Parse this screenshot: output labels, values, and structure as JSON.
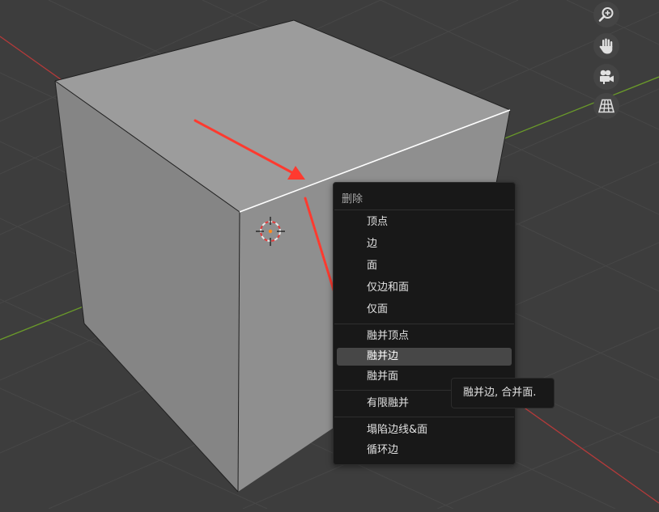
{
  "viewport": {
    "nav_icons": [
      "zoom-icon",
      "hand-pan-icon",
      "camera-icon",
      "grid-icon"
    ]
  },
  "menu": {
    "title": "删除",
    "groups": [
      [
        "顶点",
        "边",
        "面",
        "仅边和面",
        "仅面"
      ],
      [
        "融并顶点",
        "融并边",
        "融并面"
      ],
      [
        "有限融并"
      ],
      [
        "塌陷边线&面",
        "循环边"
      ]
    ],
    "highlighted": "融并边"
  },
  "tooltip": {
    "text": "融并边, 合并面."
  },
  "colors": {
    "accent_arrow": "#ff3a2f",
    "axis_x": "#b53a3a",
    "axis_y": "#6a9a2a",
    "menu_bg": "#181818",
    "highlight_bg": "#474747"
  }
}
